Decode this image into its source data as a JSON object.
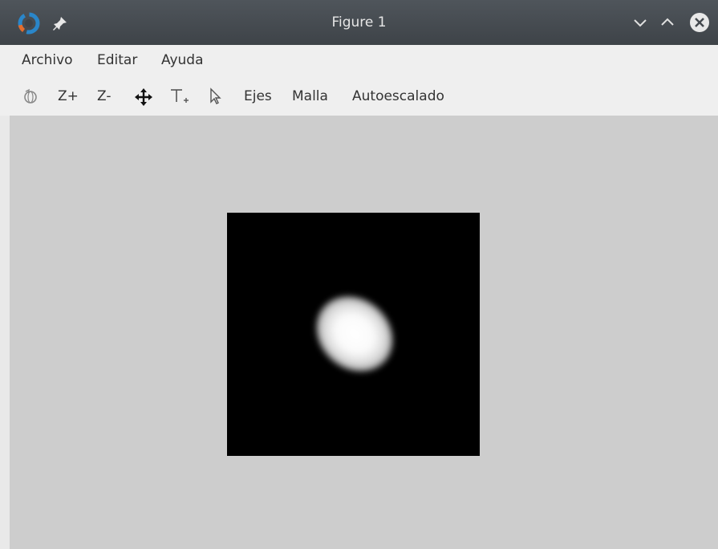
{
  "window": {
    "title": "Figure 1",
    "icons": [
      "app-logo-icon",
      "pin-icon",
      "minimize-icon",
      "maximize-icon",
      "close-icon"
    ]
  },
  "menubar": {
    "items": [
      "Archivo",
      "Editar",
      "Ayuda"
    ]
  },
  "toolbar": {
    "zoom_in": "Z+",
    "zoom_out": "Z-",
    "axes": "Ejes",
    "grid": "Malla",
    "autoscale": "Autoescalado",
    "icons": [
      "rotate-icon",
      "pan-icon",
      "text-insert-icon",
      "select-icon"
    ]
  },
  "colors": {
    "titlebar": "#44494e",
    "menubar": "#efefef",
    "canvas": "#cdcdcd",
    "image_background": "#000000",
    "close_button": "#e8e8e8"
  }
}
